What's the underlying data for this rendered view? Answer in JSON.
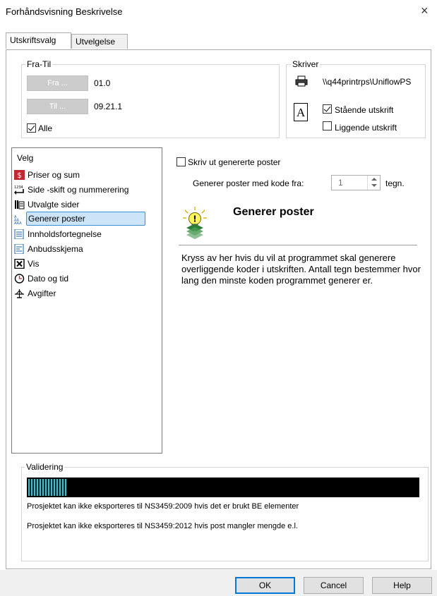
{
  "window": {
    "title": "Forhåndsvisning Beskrivelse",
    "close_glyph": "×"
  },
  "tabs": [
    {
      "label": "Utskriftsvalg",
      "active": true
    },
    {
      "label": "Utvelgelse",
      "active": false
    }
  ],
  "fra_til": {
    "legend": "Fra-Til",
    "fra_button": "Fra ...",
    "fra_value": "01.0",
    "til_button": "Til ...",
    "til_value": "09.21.1",
    "alle_label": "Alle",
    "alle_checked": true
  },
  "skriver": {
    "legend": "Skriver",
    "printer_icon": "printer-icon",
    "printer_name": "\\\\q44printrps\\UniflowPS",
    "orientation_icon": "page-orientation-icon",
    "orientation_glyph": "A",
    "staende_label": "Stående utskrift",
    "staende_checked": true,
    "liggende_label": "Liggende utskrift",
    "liggende_checked": false
  },
  "velg": {
    "header": "Velg",
    "items": [
      {
        "label": "Priser og sum",
        "icon": "price-sum-icon"
      },
      {
        "label": "Side -skift og nummerering",
        "icon": "page-break-icon"
      },
      {
        "label": "Utvalgte sider",
        "icon": "selected-pages-icon"
      },
      {
        "label": "Generer poster",
        "icon": "generate-items-icon",
        "selected": true
      },
      {
        "label": "Innholdsfortegnelse",
        "icon": "table-of-contents-icon"
      },
      {
        "label": "Anbudsskjema",
        "icon": "tender-form-icon"
      },
      {
        "label": "Vis",
        "icon": "show-icon"
      },
      {
        "label": "Dato og tid",
        "icon": "clock-icon"
      },
      {
        "label": "Avgifter",
        "icon": "fees-icon"
      }
    ]
  },
  "generer": {
    "skriv_ut_label": "Skriv ut genererte poster",
    "skriv_ut_checked": false,
    "kode_label": "Generer poster med kode fra:",
    "kode_value": "1",
    "kode_unit": "tegn.",
    "heading": "Generer poster",
    "heading_icon": "lightbulb-info-icon",
    "description": "Kryss av her hvis du vil at programmet skal generere overliggende koder i utskriften. Antall tegn bestemmer hvor lang den minste koden programmet generer er."
  },
  "validering": {
    "legend": "Validering",
    "progress_fraction": 0.1,
    "messages": [
      "Prosjektet kan ikke eksporteres til NS3459:2009 hvis det er brukt BE elementer",
      "Prosjektet kan ikke eksporteres til NS3459:2012 hvis post mangler mengde e.l."
    ]
  },
  "footer": {
    "ok": "OK",
    "cancel": "Cancel",
    "help": "Help"
  },
  "colors": {
    "selection_bg": "#cce4f7",
    "selection_border": "#3a8fd7",
    "progress": "#4bb8c8",
    "default_button": "#0078d7"
  }
}
